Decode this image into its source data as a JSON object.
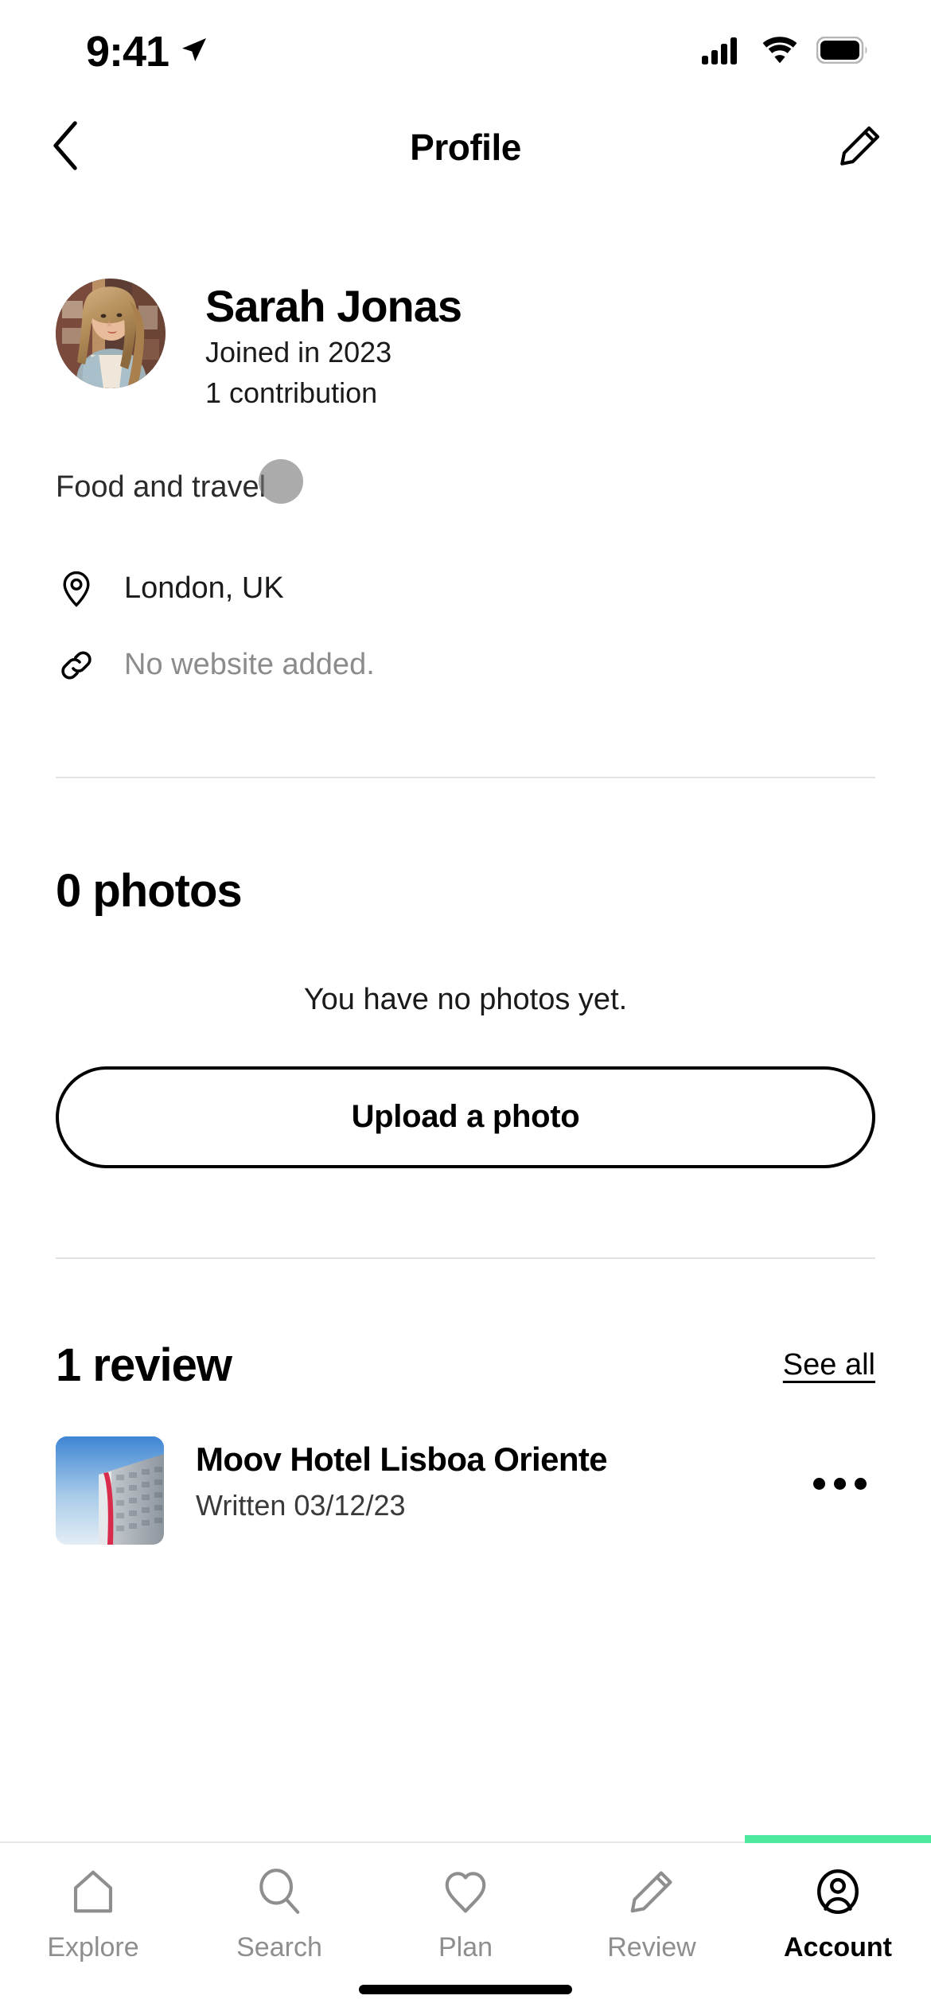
{
  "status_bar": {
    "time": "9:41",
    "location_icon": "location-arrow-icon",
    "cellular_icon": "cellular-signal-icon",
    "wifi_icon": "wifi-icon",
    "battery_icon": "battery-full-icon"
  },
  "header": {
    "back_icon": "chevron-left-icon",
    "title": "Profile",
    "edit_icon": "pencil-edit-icon"
  },
  "profile": {
    "avatar_name": "user-avatar",
    "name": "Sarah Jonas",
    "joined": "Joined in 2023",
    "contributions": "1 contribution",
    "bio": "Food and travel",
    "location_icon": "map-pin-icon",
    "location": "London, UK",
    "website_icon": "link-icon",
    "website": "No website added."
  },
  "photos": {
    "title": "0 photos",
    "empty_text": "You have no photos yet.",
    "upload_label": "Upload a photo"
  },
  "reviews": {
    "title": "1 review",
    "see_all": "See all",
    "items": [
      {
        "thumb_name": "hotel-thumbnail",
        "title": "Moov Hotel Lisboa Oriente",
        "date": "Written 03/12/23",
        "more_icon": "more-options-icon"
      }
    ]
  },
  "tabbar": {
    "active_color": "#4EE89F",
    "items": [
      {
        "label": "Explore",
        "icon": "home-icon",
        "active": false
      },
      {
        "label": "Search",
        "icon": "search-icon",
        "active": false
      },
      {
        "label": "Plan",
        "icon": "heart-icon",
        "active": false
      },
      {
        "label": "Review",
        "icon": "pencil-icon",
        "active": false
      },
      {
        "label": "Account",
        "icon": "account-circle-icon",
        "active": true
      }
    ]
  }
}
